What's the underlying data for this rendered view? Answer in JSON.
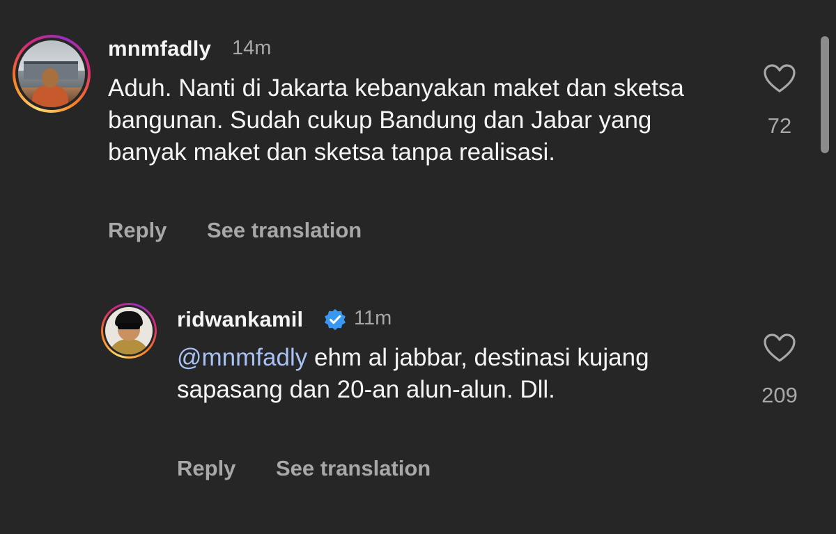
{
  "comments": [
    {
      "username": "mnmfadly",
      "time": "14m",
      "text": "Aduh. Nanti di Jakarta kebanyakan maket dan sketsa bangunan. Sudah cukup Bandung dan Jabar yang banyak maket dan sketsa tanpa realisasi.",
      "likes": "72",
      "reply_label": "Reply",
      "translate_label": "See translation"
    },
    {
      "username": "ridwankamil",
      "verified": true,
      "time": "11m",
      "mention": "@mnmfadly",
      "text": " ehm al jabbar, destinasi kujang sapasang dan 20-an alun-alun. Dll.",
      "likes": "209",
      "reply_label": "Reply",
      "translate_label": "See translation"
    }
  ],
  "icons": {
    "like": "heart-outline-icon",
    "verified": "verified-badge-icon"
  },
  "colors": {
    "background": "#262626",
    "primary_text": "#f5f5f5",
    "secondary_text": "#a8a8a8",
    "mention": "#a9c2f5",
    "verified": "#3897f0"
  }
}
